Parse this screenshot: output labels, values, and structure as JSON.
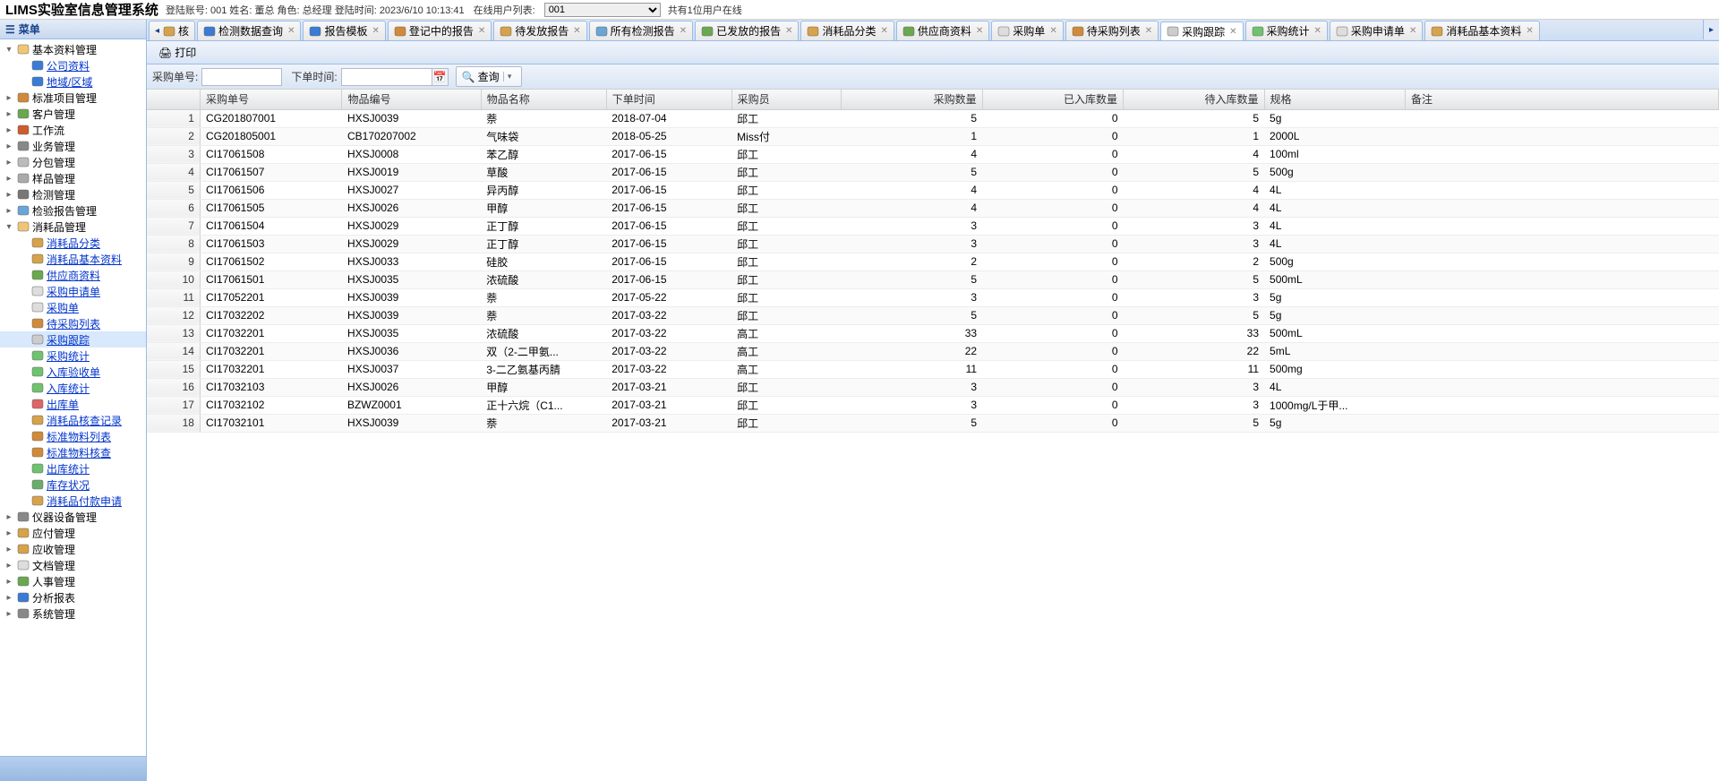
{
  "header": {
    "title": "LIMS实验室信息管理系统",
    "info1": "登陆账号: 001 姓名: 董总 角色: 总经理 登陆时间: 2023/6/10 10:13:41",
    "online_label": "在线用户列表:",
    "online_count": "共有1位用户在线",
    "select_value": "001"
  },
  "sidebar": {
    "title": "菜单",
    "nodes": [
      {
        "lvl": 1,
        "toggle": "▾",
        "label": "基本资料管理",
        "link": false,
        "icon": "folder"
      },
      {
        "lvl": 2,
        "toggle": "",
        "label": "公司资料",
        "link": true,
        "icon": "company"
      },
      {
        "lvl": 2,
        "toggle": "",
        "label": "地域/区域",
        "link": true,
        "icon": "globe"
      },
      {
        "lvl": 1,
        "toggle": "▸",
        "label": "标准项目管理",
        "link": false,
        "icon": "std"
      },
      {
        "lvl": 1,
        "toggle": "▸",
        "label": "客户管理",
        "link": false,
        "icon": "customer"
      },
      {
        "lvl": 1,
        "toggle": "▸",
        "label": "工作流",
        "link": false,
        "icon": "flow"
      },
      {
        "lvl": 1,
        "toggle": "▸",
        "label": "业务管理",
        "link": false,
        "icon": "biz"
      },
      {
        "lvl": 1,
        "toggle": "▸",
        "label": "分包管理",
        "link": false,
        "icon": "sub"
      },
      {
        "lvl": 1,
        "toggle": "▸",
        "label": "样品管理",
        "link": false,
        "icon": "sample"
      },
      {
        "lvl": 1,
        "toggle": "▸",
        "label": "检测管理",
        "link": false,
        "icon": "test"
      },
      {
        "lvl": 1,
        "toggle": "▸",
        "label": "检验报告管理",
        "link": false,
        "icon": "report"
      },
      {
        "lvl": 1,
        "toggle": "▾",
        "label": "消耗品管理",
        "link": false,
        "icon": "folder"
      },
      {
        "lvl": 2,
        "toggle": "",
        "label": "消耗品分类",
        "link": true,
        "icon": "box"
      },
      {
        "lvl": 2,
        "toggle": "",
        "label": "消耗品基本资料",
        "link": true,
        "icon": "box"
      },
      {
        "lvl": 2,
        "toggle": "",
        "label": "供应商资料",
        "link": true,
        "icon": "supplier"
      },
      {
        "lvl": 2,
        "toggle": "",
        "label": "采购申请单",
        "link": true,
        "icon": "doc"
      },
      {
        "lvl": 2,
        "toggle": "",
        "label": "采购单",
        "link": true,
        "icon": "doc"
      },
      {
        "lvl": 2,
        "toggle": "",
        "label": "待采购列表",
        "link": true,
        "icon": "list"
      },
      {
        "lvl": 2,
        "toggle": "",
        "label": "采购跟踪",
        "link": true,
        "icon": "track",
        "selected": true
      },
      {
        "lvl": 2,
        "toggle": "",
        "label": "采购统计",
        "link": true,
        "icon": "stat"
      },
      {
        "lvl": 2,
        "toggle": "",
        "label": "入库验收单",
        "link": true,
        "icon": "in"
      },
      {
        "lvl": 2,
        "toggle": "",
        "label": "入库统计",
        "link": true,
        "icon": "stat"
      },
      {
        "lvl": 2,
        "toggle": "",
        "label": "出库单",
        "link": true,
        "icon": "out"
      },
      {
        "lvl": 2,
        "toggle": "",
        "label": "消耗品核查记录",
        "link": true,
        "icon": "check"
      },
      {
        "lvl": 2,
        "toggle": "",
        "label": "标准物料列表",
        "link": true,
        "icon": "std"
      },
      {
        "lvl": 2,
        "toggle": "",
        "label": "标准物料核查",
        "link": true,
        "icon": "std"
      },
      {
        "lvl": 2,
        "toggle": "",
        "label": "出库统计",
        "link": true,
        "icon": "stat"
      },
      {
        "lvl": 2,
        "toggle": "",
        "label": "库存状况",
        "link": true,
        "icon": "stock"
      },
      {
        "lvl": 2,
        "toggle": "",
        "label": "消耗品付款申请",
        "link": true,
        "icon": "pay"
      },
      {
        "lvl": 1,
        "toggle": "▸",
        "label": "仪器设备管理",
        "link": false,
        "icon": "device"
      },
      {
        "lvl": 1,
        "toggle": "▸",
        "label": "应付管理",
        "link": false,
        "icon": "pay"
      },
      {
        "lvl": 1,
        "toggle": "▸",
        "label": "应收管理",
        "link": false,
        "icon": "pay"
      },
      {
        "lvl": 1,
        "toggle": "▸",
        "label": "文档管理",
        "link": false,
        "icon": "doc"
      },
      {
        "lvl": 1,
        "toggle": "▸",
        "label": "人事管理",
        "link": false,
        "icon": "hr"
      },
      {
        "lvl": 1,
        "toggle": "▸",
        "label": "分析报表",
        "link": false,
        "icon": "chart"
      },
      {
        "lvl": 1,
        "toggle": "▸",
        "label": "系统管理",
        "link": false,
        "icon": "sys"
      }
    ]
  },
  "tabs": [
    {
      "label": "核",
      "icon": "check",
      "closable": false,
      "leftarrow": true
    },
    {
      "label": "检测数据查询",
      "icon": "search",
      "closable": true
    },
    {
      "label": "报告模板",
      "icon": "tpl",
      "closable": true
    },
    {
      "label": "登记中的报告",
      "icon": "reg",
      "closable": true
    },
    {
      "label": "待发放报告",
      "icon": "wait",
      "closable": true
    },
    {
      "label": "所有检测报告",
      "icon": "all",
      "closable": true
    },
    {
      "label": "已发放的报告",
      "icon": "sent",
      "closable": true
    },
    {
      "label": "消耗品分类",
      "icon": "box",
      "closable": true
    },
    {
      "label": "供应商资料",
      "icon": "supplier",
      "closable": true
    },
    {
      "label": "采购单",
      "icon": "doc",
      "closable": true
    },
    {
      "label": "待采购列表",
      "icon": "list",
      "closable": true
    },
    {
      "label": "采购跟踪",
      "icon": "track",
      "closable": true,
      "active": true
    },
    {
      "label": "采购统计",
      "icon": "stat",
      "closable": true
    },
    {
      "label": "采购申请单",
      "icon": "doc",
      "closable": true
    },
    {
      "label": "消耗品基本资料",
      "icon": "box",
      "closable": true
    }
  ],
  "toolbar": {
    "print": "打印"
  },
  "search": {
    "l1": "采购单号:",
    "l2": "下单时间:",
    "btn": "查询"
  },
  "grid": {
    "columns": [
      "",
      "采购单号",
      "物品编号",
      "物品名称",
      "下单时间",
      "采购员",
      "采购数量",
      "已入库数量",
      "待入库数量",
      "规格",
      "备注"
    ],
    "numcols": [
      6,
      7,
      8
    ],
    "rows": [
      [
        "1",
        "CG201807001",
        "HXSJ0039",
        "萘",
        "2018-07-04",
        "邱工",
        "5",
        "0",
        "5",
        "5g",
        ""
      ],
      [
        "2",
        "CG201805001",
        "CB170207002",
        "气味袋",
        "2018-05-25",
        "Miss付",
        "1",
        "0",
        "1",
        "2000L",
        ""
      ],
      [
        "3",
        "CI17061508",
        "HXSJ0008",
        "苯乙醇",
        "2017-06-15",
        "邱工",
        "4",
        "0",
        "4",
        "100ml",
        ""
      ],
      [
        "4",
        "CI17061507",
        "HXSJ0019",
        "草酸",
        "2017-06-15",
        "邱工",
        "5",
        "0",
        "5",
        "500g",
        ""
      ],
      [
        "5",
        "CI17061506",
        "HXSJ0027",
        "异丙醇",
        "2017-06-15",
        "邱工",
        "4",
        "0",
        "4",
        "4L",
        ""
      ],
      [
        "6",
        "CI17061505",
        "HXSJ0026",
        "甲醇",
        "2017-06-15",
        "邱工",
        "4",
        "0",
        "4",
        "4L",
        ""
      ],
      [
        "7",
        "CI17061504",
        "HXSJ0029",
        "正丁醇",
        "2017-06-15",
        "邱工",
        "3",
        "0",
        "3",
        "4L",
        ""
      ],
      [
        "8",
        "CI17061503",
        "HXSJ0029",
        "正丁醇",
        "2017-06-15",
        "邱工",
        "3",
        "0",
        "3",
        "4L",
        ""
      ],
      [
        "9",
        "CI17061502",
        "HXSJ0033",
        "硅胶",
        "2017-06-15",
        "邱工",
        "2",
        "0",
        "2",
        "500g",
        ""
      ],
      [
        "10",
        "CI17061501",
        "HXSJ0035",
        "浓硫酸",
        "2017-06-15",
        "邱工",
        "5",
        "0",
        "5",
        "500mL",
        ""
      ],
      [
        "11",
        "CI17052201",
        "HXSJ0039",
        "萘",
        "2017-05-22",
        "邱工",
        "3",
        "0",
        "3",
        "5g",
        ""
      ],
      [
        "12",
        "CI17032202",
        "HXSJ0039",
        "萘",
        "2017-03-22",
        "邱工",
        "5",
        "0",
        "5",
        "5g",
        ""
      ],
      [
        "13",
        "CI17032201",
        "HXSJ0035",
        "浓硫酸",
        "2017-03-22",
        "高工",
        "33",
        "0",
        "33",
        "500mL",
        ""
      ],
      [
        "14",
        "CI17032201",
        "HXSJ0036",
        "双（2-二甲氨...",
        "2017-03-22",
        "高工",
        "22",
        "0",
        "22",
        "5mL",
        ""
      ],
      [
        "15",
        "CI17032201",
        "HXSJ0037",
        "3-二乙氨基丙腈",
        "2017-03-22",
        "高工",
        "11",
        "0",
        "11",
        "500mg",
        ""
      ],
      [
        "16",
        "CI17032103",
        "HXSJ0026",
        "甲醇",
        "2017-03-21",
        "邱工",
        "3",
        "0",
        "3",
        "4L",
        ""
      ],
      [
        "17",
        "CI17032102",
        "BZWZ0001",
        "正十六烷（C1...",
        "2017-03-21",
        "邱工",
        "3",
        "0",
        "3",
        "1000mg/L于甲...",
        ""
      ],
      [
        "18",
        "CI17032101",
        "HXSJ0039",
        "萘",
        "2017-03-21",
        "邱工",
        "5",
        "0",
        "5",
        "5g",
        ""
      ]
    ]
  }
}
